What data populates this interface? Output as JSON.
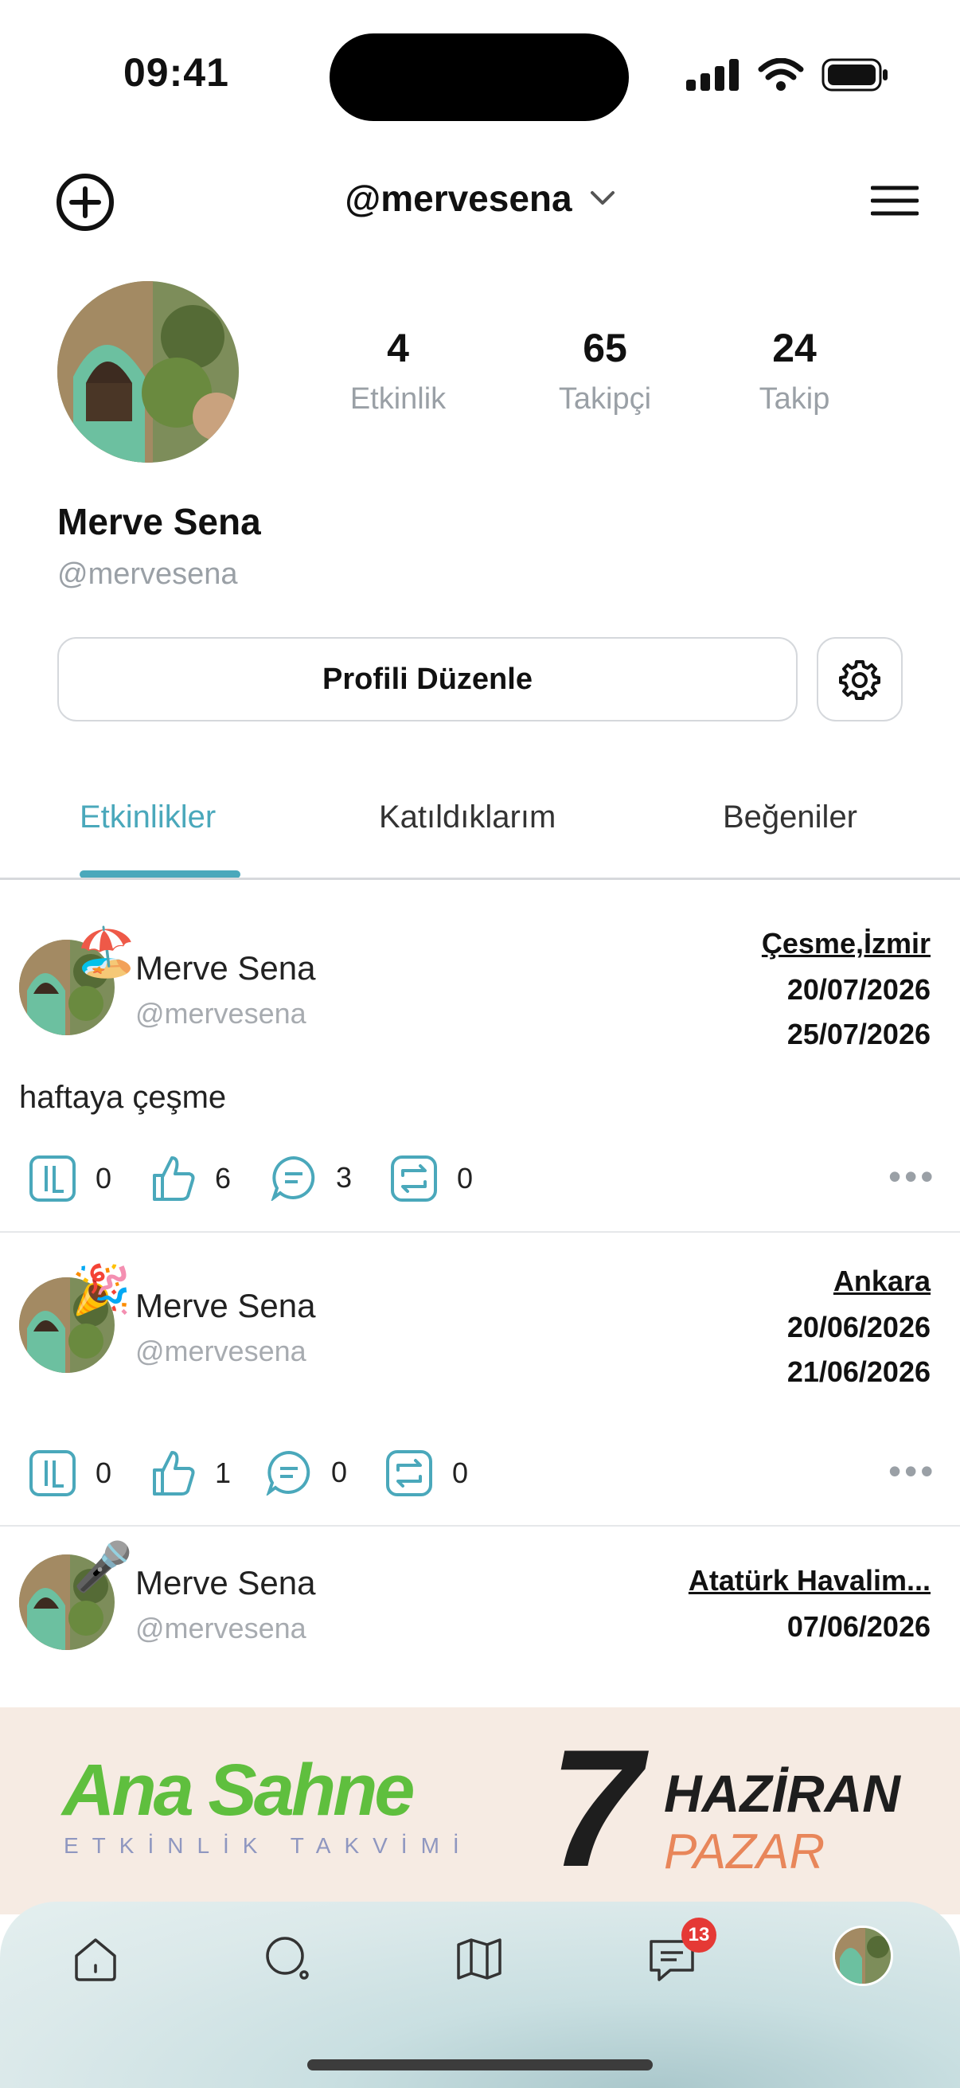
{
  "status_bar": {
    "time": "09:41"
  },
  "header": {
    "username": "@mervesena"
  },
  "profile": {
    "stats": [
      {
        "value": "4",
        "label": "Etkinlik"
      },
      {
        "value": "65",
        "label": "Takipçi"
      },
      {
        "value": "24",
        "label": "Takip"
      }
    ],
    "name": "Merve Sena",
    "handle": "@mervesena",
    "edit_label": "Profili Düzenle"
  },
  "tabs": [
    "Etkinlikler",
    "Katıldıklarım",
    "Beğeniler"
  ],
  "posts": [
    {
      "name": "Merve Sena",
      "handle": "@mervesena",
      "emoji": "🏖️",
      "location": "Çesme,İzmir",
      "date_start": "20/07/2026",
      "date_end": "25/07/2026",
      "text": "haftaya çeşme",
      "counts": {
        "join": "0",
        "like": "6",
        "comment": "3",
        "repost": "0"
      }
    },
    {
      "name": "Merve Sena",
      "handle": "@mervesena",
      "emoji": "🎉",
      "location": "Ankara",
      "date_start": "20/06/2026",
      "date_end": "21/06/2026",
      "text": "",
      "counts": {
        "join": "0",
        "like": "1",
        "comment": "0",
        "repost": "0"
      }
    },
    {
      "name": "Merve Sena",
      "handle": "@mervesena",
      "emoji": "🎤",
      "location": "Atatürk Havalim...",
      "date_start": "07/06/2026",
      "date_end": "",
      "text": ""
    }
  ],
  "banner": {
    "brand": "Ana Sahne",
    "subtitle": "ETKİNLİK TAKVİMİ",
    "day": "7",
    "month": "HAZİRAN",
    "weekday": "PAZAR"
  },
  "nav": {
    "messages_badge": "13"
  },
  "colors": {
    "accent": "#4aa8bb",
    "badge": "#e53935"
  }
}
